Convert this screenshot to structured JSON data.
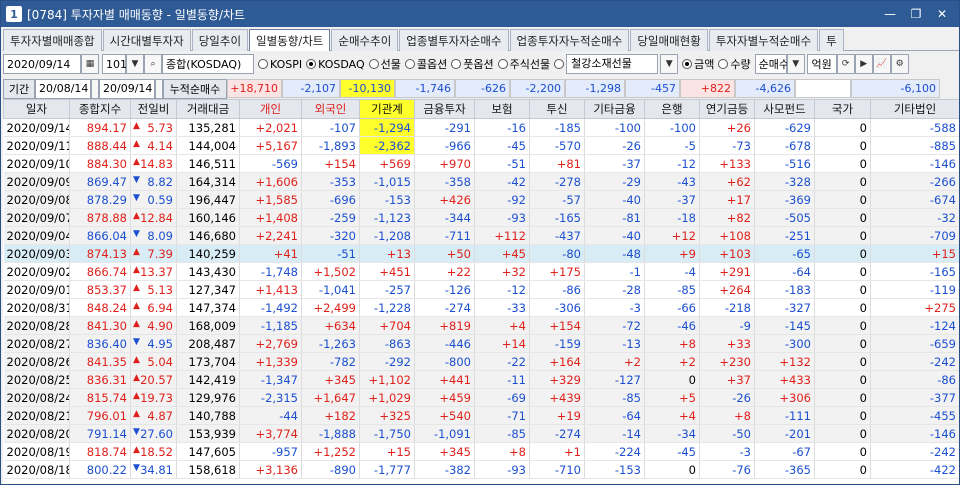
{
  "window": {
    "number": "1",
    "title": "[0784] 투자자별 매매동향 - 일별동향/차트"
  },
  "tabs": [
    "투자자별매매종합",
    "시간대별투자자",
    "당일추이",
    "일별동향/차트",
    "순매수추이",
    "업종별투자자순매수",
    "업종투자자누적순매수",
    "당일매매현황",
    "투자자별누적순매수",
    "투"
  ],
  "active_tab": 3,
  "toolbar": {
    "date": "2020/09/14",
    "code": "101",
    "market": "종합(KOSDAQ)",
    "radios": [
      "KOSPI",
      "KOSDAQ",
      "선물",
      "콜옵션",
      "풋옵션",
      "주식선물",
      "철강소재선물"
    ],
    "radio_selected": 1,
    "unit_radios": [
      "금액",
      "수량"
    ],
    "unit_selected": 0,
    "mode": "순매수",
    "unit_label": "억원"
  },
  "period": {
    "label": "기간",
    "from": "20/08/14",
    "to": "20/09/14",
    "sum_label": "누적순매수"
  },
  "sums": [
    "+18,710",
    "-2,107",
    "-10,130",
    "-1,746",
    "-626",
    "-2,200",
    "-1,298",
    "-457",
    "+822",
    "-4,626",
    "",
    "-6,100"
  ],
  "columns": [
    "일자",
    "종합지수",
    "전일비",
    "거래대금",
    "개인",
    "외국인",
    "기관계",
    "금융투자",
    "보험",
    "투신",
    "기타금융",
    "은행",
    "연기금등",
    "사모펀드",
    "국가",
    "기타법인"
  ],
  "rows": [
    [
      "2020/09/14",
      "894.17",
      "5.73",
      "135,281",
      "+2,021",
      "-107",
      "-1,294",
      "-291",
      "-16",
      "-185",
      "-100",
      "-100",
      "+26",
      "-629",
      "0",
      "-588"
    ],
    [
      "2020/09/11",
      "888.44",
      "4.14",
      "144,004",
      "+5,167",
      "-1,893",
      "-2,362",
      "-966",
      "-45",
      "-570",
      "-26",
      "-5",
      "-73",
      "-678",
      "0",
      "-885"
    ],
    [
      "2020/09/10",
      "884.30",
      "14.83",
      "146,511",
      "-569",
      "+154",
      "+569",
      "+970",
      "-51",
      "+81",
      "-37",
      "-12",
      "+133",
      "-516",
      "0",
      "-146"
    ],
    [
      "2020/09/09",
      "869.47",
      "8.82",
      "164,314",
      "+1,606",
      "-353",
      "-1,015",
      "-358",
      "-42",
      "-278",
      "-29",
      "-43",
      "+62",
      "-328",
      "0",
      "-266"
    ],
    [
      "2020/09/08",
      "878.29",
      "0.59",
      "196,447",
      "+1,585",
      "-696",
      "-153",
      "+426",
      "-92",
      "-57",
      "-40",
      "-37",
      "+17",
      "-369",
      "0",
      "-674"
    ],
    [
      "2020/09/07",
      "878.88",
      "12.84",
      "160,146",
      "+1,408",
      "-259",
      "-1,123",
      "-344",
      "-93",
      "-165",
      "-81",
      "-18",
      "+82",
      "-505",
      "0",
      "-32"
    ],
    [
      "2020/09/04",
      "866.04",
      "8.09",
      "146,680",
      "+2,241",
      "-320",
      "-1,208",
      "-711",
      "+112",
      "-437",
      "-40",
      "+12",
      "+108",
      "-251",
      "0",
      "-709"
    ],
    [
      "2020/09/03",
      "874.13",
      "7.39",
      "140,259",
      "+41",
      "-51",
      "+13",
      "+50",
      "+45",
      "-80",
      "-48",
      "+9",
      "+103",
      "-65",
      "0",
      "+15"
    ],
    [
      "2020/09/02",
      "866.74",
      "13.37",
      "143,430",
      "-1,748",
      "+1,502",
      "+451",
      "+22",
      "+32",
      "+175",
      "-1",
      "-4",
      "+291",
      "-64",
      "0",
      "-165"
    ],
    [
      "2020/09/01",
      "853.37",
      "5.13",
      "127,347",
      "+1,413",
      "-1,041",
      "-257",
      "-126",
      "-12",
      "-86",
      "-28",
      "-85",
      "+264",
      "-183",
      "0",
      "-119"
    ],
    [
      "2020/08/31",
      "848.24",
      "6.94",
      "147,374",
      "-1,492",
      "+2,499",
      "-1,228",
      "-274",
      "-33",
      "-306",
      "-3",
      "-66",
      "-218",
      "-327",
      "0",
      "+275"
    ],
    [
      "2020/08/28",
      "841.30",
      "4.90",
      "168,009",
      "-1,185",
      "+634",
      "+704",
      "+819",
      "+4",
      "+154",
      "-72",
      "-46",
      "-9",
      "-145",
      "0",
      "-124"
    ],
    [
      "2020/08/27",
      "836.40",
      "4.95",
      "208,487",
      "+2,769",
      "-1,263",
      "-863",
      "-446",
      "+14",
      "-159",
      "-13",
      "+8",
      "+33",
      "-300",
      "0",
      "-659"
    ],
    [
      "2020/08/26",
      "841.35",
      "5.04",
      "173,704",
      "+1,339",
      "-782",
      "-292",
      "-800",
      "-22",
      "+164",
      "+2",
      "+2",
      "+230",
      "+132",
      "0",
      "-242"
    ],
    [
      "2020/08/25",
      "836.31",
      "20.57",
      "142,419",
      "-1,347",
      "+345",
      "+1,102",
      "+441",
      "-11",
      "+329",
      "-127",
      "0",
      "+37",
      "+433",
      "0",
      "-86"
    ],
    [
      "2020/08/24",
      "815.74",
      "19.73",
      "129,976",
      "-2,315",
      "+1,647",
      "+1,029",
      "+459",
      "-69",
      "+439",
      "-85",
      "+5",
      "-26",
      "+306",
      "0",
      "-377"
    ],
    [
      "2020/08/21",
      "796.01",
      "4.87",
      "140,788",
      "-44",
      "+182",
      "+325",
      "+540",
      "-71",
      "+19",
      "-64",
      "+4",
      "+8",
      "-111",
      "0",
      "-455"
    ],
    [
      "2020/08/20",
      "791.14",
      "27.60",
      "153,939",
      "+3,774",
      "-1,888",
      "-1,750",
      "-1,091",
      "-85",
      "-274",
      "-14",
      "-34",
      "-50",
      "-201",
      "0",
      "-146"
    ],
    [
      "2020/08/19",
      "818.74",
      "18.52",
      "147,605",
      "-957",
      "+1,252",
      "+15",
      "+345",
      "+8",
      "+1",
      "-224",
      "-45",
      "-3",
      "-67",
      "0",
      "-242"
    ],
    [
      "2020/08/18",
      "800.22",
      "34.81",
      "158,618",
      "+3,136",
      "-890",
      "-1,777",
      "-382",
      "-93",
      "-710",
      "-153",
      "0",
      "-76",
      "-365",
      "0",
      "-422"
    ]
  ],
  "row_direction": [
    "up",
    "up",
    "up",
    "dn",
    "dn",
    "up",
    "dn",
    "up",
    "up",
    "up",
    "up",
    "up",
    "dn",
    "up",
    "up",
    "up",
    "up",
    "dn",
    "up",
    "dn"
  ],
  "highlight_column": 6,
  "highlight_rows": 2,
  "selected_row": 7,
  "colors": {
    "title_bar": "#2e5a95",
    "up": "#e0201a",
    "down": "#1b4fd0",
    "highlight": "#ffff2b",
    "selected_row": "#d7ecf4"
  }
}
